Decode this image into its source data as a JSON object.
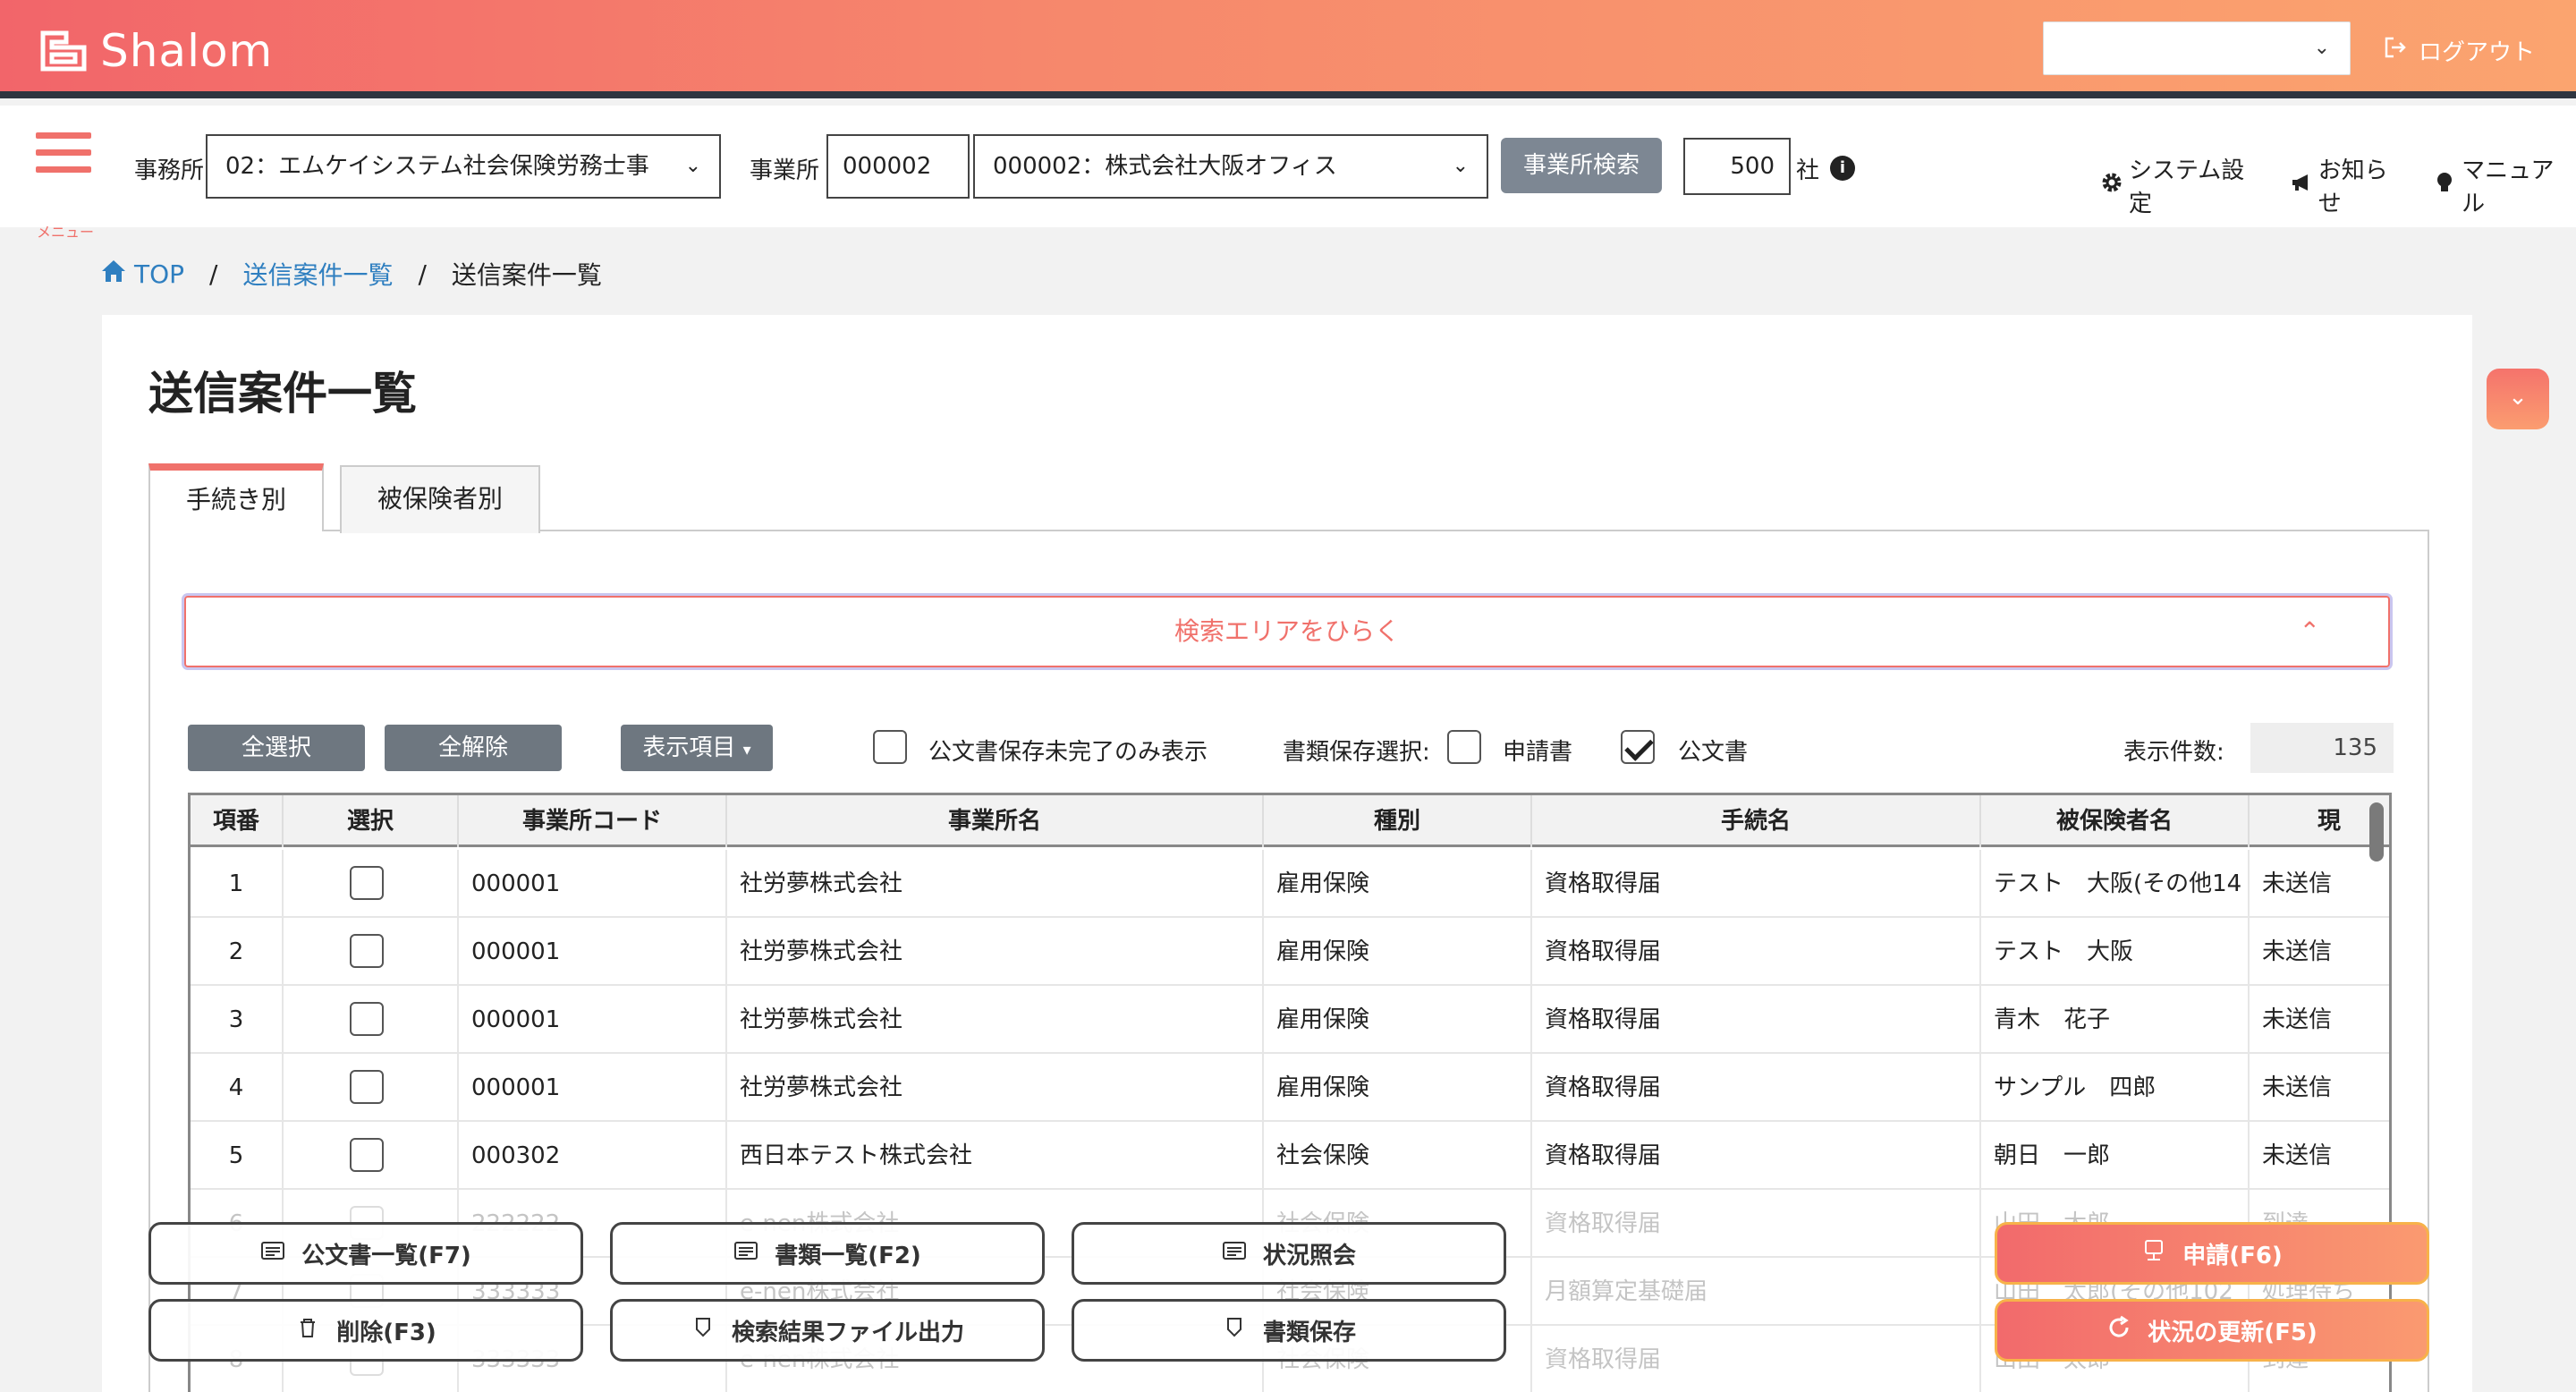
{
  "app": {
    "logo_text": "Shalom",
    "logout_label": "ログアウト"
  },
  "header": {
    "top_select_value": "",
    "menu_label": "メニュー",
    "office_label": "事務所",
    "office_value": "02：エムケイシステム社会保険労務士事",
    "site_label": "事業所",
    "site_code": "000002",
    "site_value": "000002：株式会社大阪オフィス",
    "site_search_button": "事業所検索",
    "company_count": "500",
    "company_unit": "社",
    "links": [
      "システム設定",
      "お知らせ",
      "マニュアル"
    ]
  },
  "breadcrumb": {
    "items": [
      "TOP",
      "送信案件一覧",
      "送信案件一覧"
    ]
  },
  "page": {
    "title": "送信案件一覧",
    "tabs": [
      "手続き別",
      "被保険者別"
    ],
    "search_toggle": "検索エリアをひらく",
    "toolbar": {
      "select_all": "全選択",
      "deselect_all": "全解除",
      "display_items": "表示項目",
      "only_incomplete": "公文書保存未完了のみ表示",
      "doc_save_label": "書類保存選択:",
      "doc_application": "申請書",
      "doc_official": "公文書",
      "count_label": "表示件数:",
      "count_value": "135"
    }
  },
  "table": {
    "headers": [
      "項番",
      "選択",
      "事業所コード",
      "事業所名",
      "種別",
      "手続名",
      "被保険者名",
      "現"
    ],
    "rows": [
      [
        "1",
        "",
        "000001",
        "社労夢株式会社",
        "雇用保険",
        "資格取得届",
        "テスト　大阪(その他14",
        "未送信"
      ],
      [
        "2",
        "",
        "000001",
        "社労夢株式会社",
        "雇用保険",
        "資格取得届",
        "テスト　大阪",
        "未送信"
      ],
      [
        "3",
        "",
        "000001",
        "社労夢株式会社",
        "雇用保険",
        "資格取得届",
        "青木　花子",
        "未送信"
      ],
      [
        "4",
        "",
        "000001",
        "社労夢株式会社",
        "雇用保険",
        "資格取得届",
        "サンプル　四郎",
        "未送信"
      ],
      [
        "5",
        "",
        "000302",
        "西日本テスト株式会社",
        "社会保険",
        "資格取得届",
        "朝日　一郎",
        "未送信"
      ],
      [
        "6",
        "",
        "222222",
        "e-nen株式会社",
        "社会保険",
        "資格取得届",
        "山田　太郎",
        "到達"
      ],
      [
        "7",
        "",
        "333333",
        "e-nen株式会社",
        "社会保険",
        "月額算定基礎届",
        "山田　太郎(その他102",
        "処理待ち"
      ],
      [
        "8",
        "",
        "333333",
        "e-nen株式会社",
        "社会保険",
        "資格取得届",
        "山田　太郎",
        "到達"
      ]
    ]
  },
  "actions": {
    "official_list": "公文書一覧(F7)",
    "doc_list": "書類一覧(F2)",
    "status_inquiry": "状況照会",
    "apply": "申請(F6)",
    "delete": "削除(F3)",
    "export": "検索結果ファイル出力",
    "doc_save": "書類保存",
    "refresh": "状況の更新(F5)"
  },
  "colors": {
    "accent": "#f0716b",
    "link": "#2f7fc0",
    "dark_bar": "#2f3540"
  }
}
